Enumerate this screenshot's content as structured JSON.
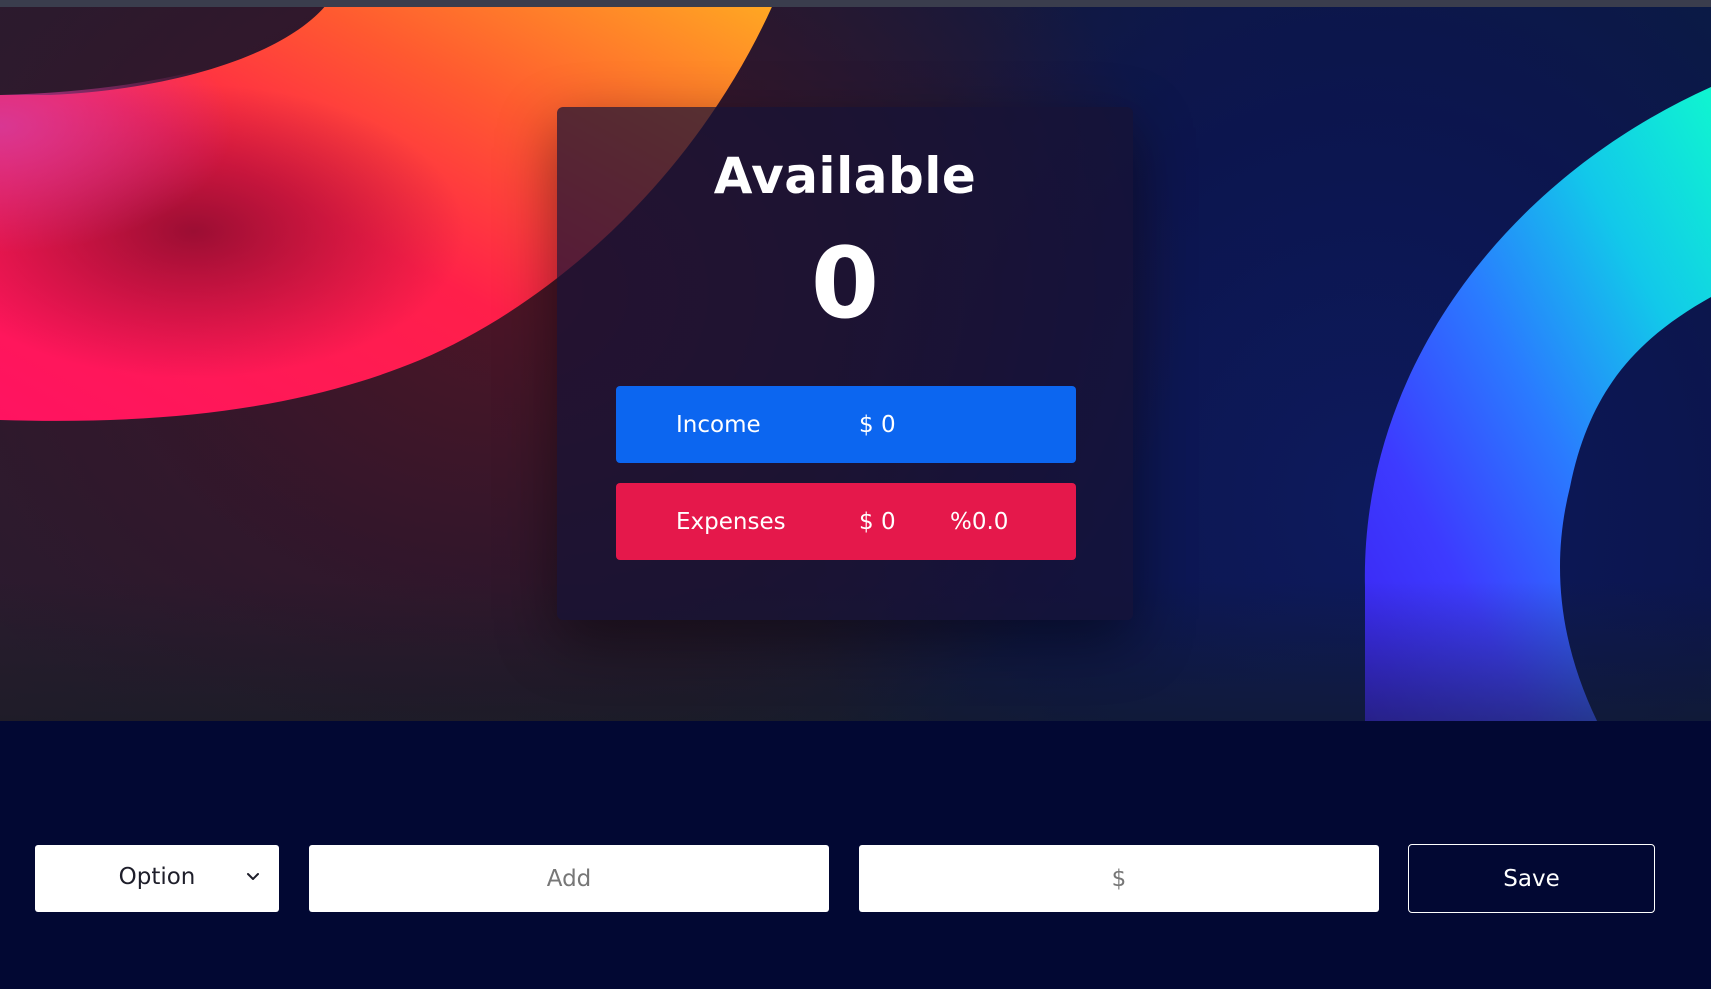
{
  "summary": {
    "title": "Available",
    "available_amount": "0"
  },
  "income": {
    "label": "Income",
    "amount": "$ 0"
  },
  "expenses": {
    "label": "Expenses",
    "amount": "$ 0",
    "percentage": "%0.0"
  },
  "form": {
    "type_select": {
      "selected": "Option"
    },
    "description_placeholder": "Add",
    "value_placeholder": "$",
    "save_label": "Save"
  },
  "colors": {
    "income": "#0c66f0",
    "expenses": "#e5184b",
    "background": "#020833"
  }
}
